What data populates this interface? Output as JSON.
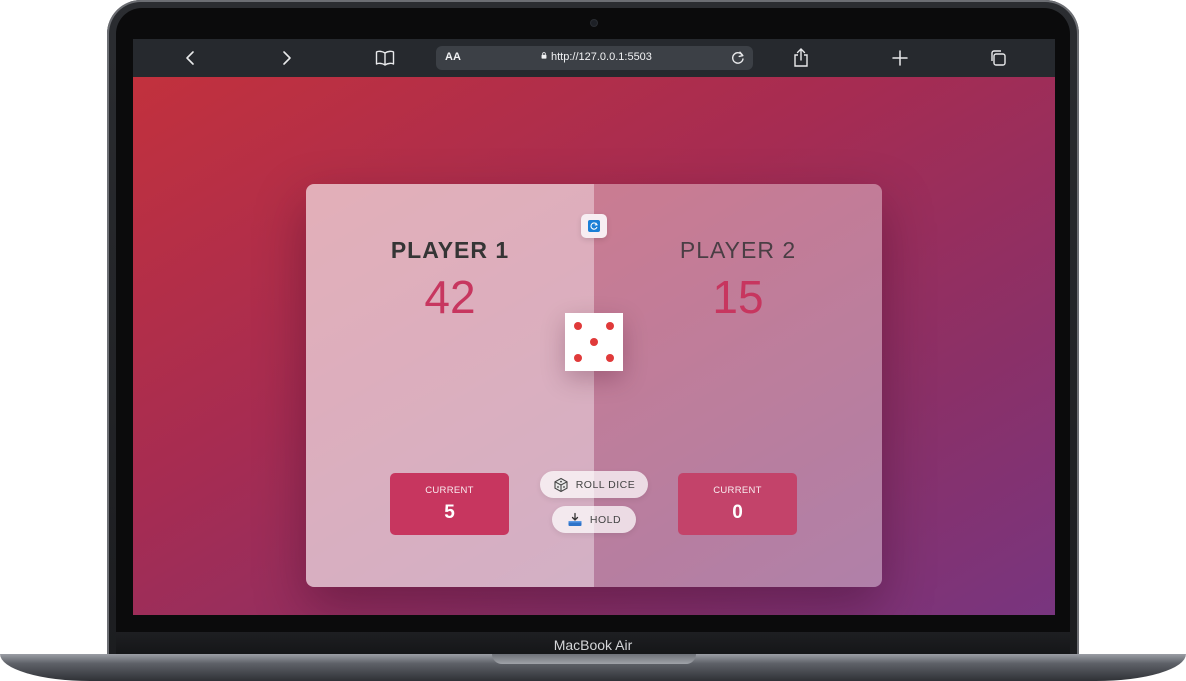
{
  "device": {
    "label": "MacBook Air"
  },
  "browser": {
    "address_prefix": "AA",
    "url": "http://127.0.0.1:5503",
    "icons": [
      "back-icon",
      "forward-icon",
      "bookmarks-icon",
      "lock-icon",
      "reload-icon",
      "share-icon",
      "new-tab-icon",
      "tabs-icon"
    ]
  },
  "game": {
    "players": [
      {
        "name": "PLAYER 1",
        "score": "42",
        "current_label": "CURRENT",
        "current": "5",
        "active": true
      },
      {
        "name": "PLAYER 2",
        "score": "15",
        "current_label": "CURRENT",
        "current": "0",
        "active": false
      }
    ],
    "dice_value": 5,
    "buttons": {
      "roll": "ROLL DICE",
      "hold": "HOLD"
    },
    "colors": {
      "accent": "#c7365f",
      "dice_dot": "#e03a3a",
      "bg_start": "#c2313d",
      "bg_end": "#78357f"
    }
  }
}
